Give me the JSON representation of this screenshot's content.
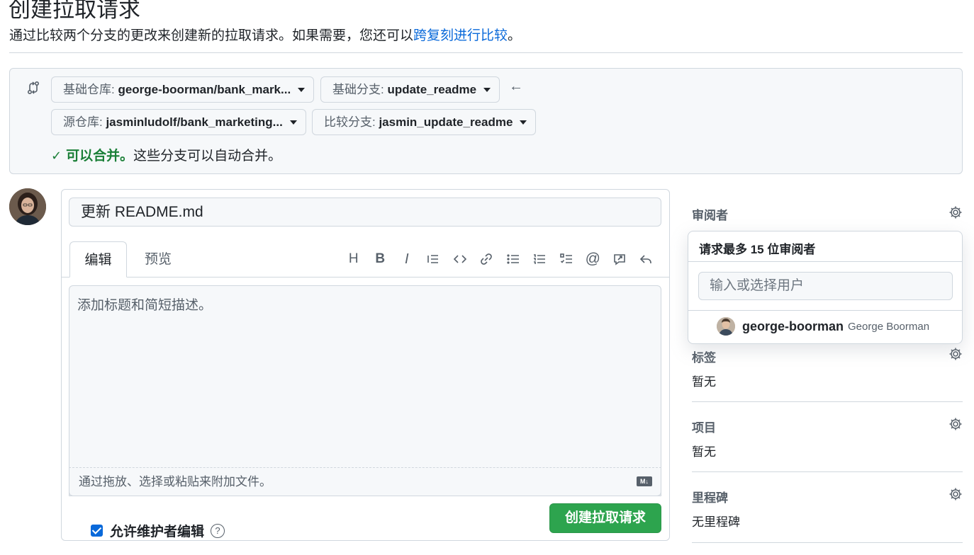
{
  "header": {
    "title": "创建拉取请求",
    "subtitle_prefix": "通过比较两个分支的更改来创建新的拉取请求。如果需要，您还可以",
    "subtitle_link": "跨复刻进行比较",
    "subtitle_suffix": "。"
  },
  "compare": {
    "base_repo_label": "基础仓库: ",
    "base_repo_value": "george-boorman/bank_mark...",
    "base_branch_label": "基础分支: ",
    "base_branch_value": "update_readme",
    "head_repo_label": "源仓库: ",
    "head_repo_value": "jasminludolf/bank_marketing...",
    "compare_branch_label": "比较分支: ",
    "compare_branch_value": "jasmin_update_readme",
    "arrow": "←",
    "merge_ok": "可以合并。",
    "merge_desc": "这些分支可以自动合并。"
  },
  "editor": {
    "title_value": "更新 README.md",
    "tab_write": "编辑",
    "tab_preview": "预览",
    "body_placeholder": "添加标题和简短描述。",
    "attach_hint": "通过拖放、选择或粘贴来附加文件。",
    "md_badge": "M↓",
    "maintainer_edit_label": "允许维护者编辑",
    "help_glyph": "?",
    "submit_label": "创建拉取请求"
  },
  "toolbar_icons": [
    "heading-icon",
    "bold-icon",
    "italic-icon",
    "quote-icon",
    "code-icon",
    "link-icon",
    "unordered-list-icon",
    "ordered-list-icon",
    "task-list-icon",
    "mention-icon",
    "reference-icon",
    "reply-icon"
  ],
  "toolbar_glyphs": {
    "heading": "H",
    "bold": "B",
    "italic": "I",
    "mention": "@"
  },
  "sidebar": {
    "reviewers_label": "审阅者",
    "labels_label": "标签",
    "labels_value": "暂无",
    "projects_label": "项目",
    "projects_value": "暂无",
    "milestone_label": "里程碑",
    "milestone_value": "无里程碑"
  },
  "reviewer_popover": {
    "title": "请求最多 15 位审阅者",
    "search_placeholder": "输入或选择用户",
    "user_login": "george-boorman",
    "user_fullname": "George Boorman"
  },
  "colors": {
    "accent_blue": "#0969da",
    "success_green": "#1a7f37",
    "button_green": "#2da44e"
  }
}
